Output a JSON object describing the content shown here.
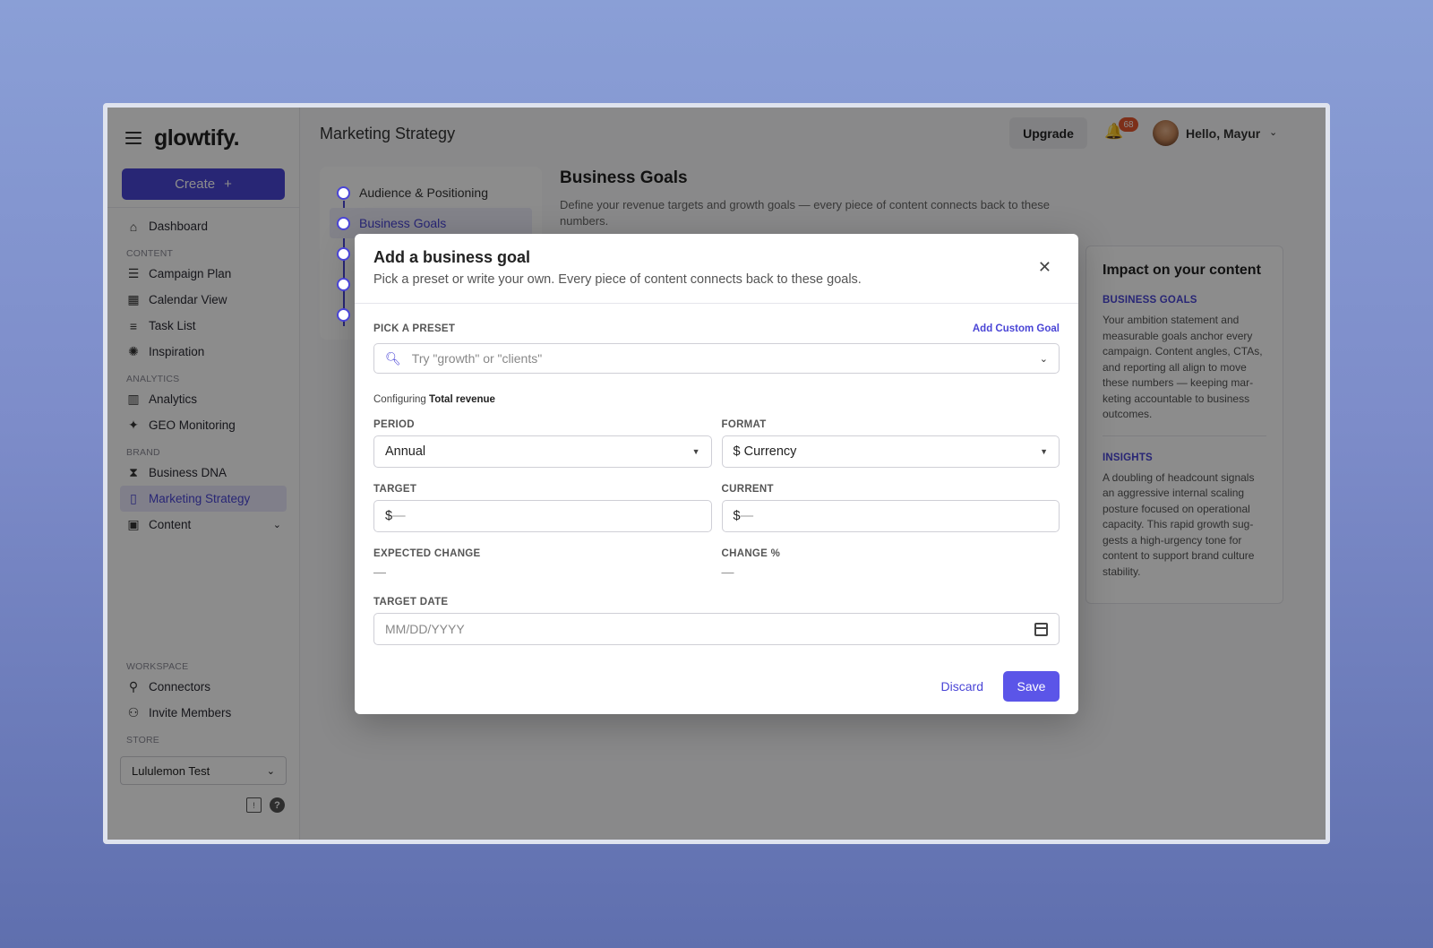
{
  "sidebar": {
    "logo": "glowtify.",
    "create_label": "Create",
    "create_plus": "+",
    "items": [
      {
        "label": "Dashboard",
        "icon": "home-icon"
      },
      {
        "label": "Campaign Plan",
        "icon": "campaign-plan-icon"
      },
      {
        "label": "Calendar View",
        "icon": "calendar-icon"
      },
      {
        "label": "Task List",
        "icon": "task-list-icon"
      },
      {
        "label": "Inspiration",
        "icon": "lightbulb-icon"
      },
      {
        "label": "Analytics",
        "icon": "bar-chart-icon"
      },
      {
        "label": "GEO Monitoring",
        "icon": "sparkle-icon"
      },
      {
        "label": "Business DNA",
        "icon": "dna-icon"
      },
      {
        "label": "Marketing Strategy",
        "icon": "book-icon"
      },
      {
        "label": "Content",
        "icon": "image-gallery-icon"
      },
      {
        "label": "Connectors",
        "icon": "connectors-icon"
      },
      {
        "label": "Invite Members",
        "icon": "invite-members-icon"
      }
    ],
    "sections": {
      "content": "CONTENT",
      "analytics": "ANALYTICS",
      "brand": "BRAND",
      "workspace": "WORKSPACE",
      "store": "STORE"
    },
    "store_value": "Lululemon Test"
  },
  "header": {
    "page_title": "Marketing Strategy",
    "upgrade_label": "Upgrade",
    "notification_count": "68",
    "greeting": "Hello, Mayur"
  },
  "steps": [
    {
      "label": "Audience & Positioning"
    },
    {
      "label": "Business Goals"
    }
  ],
  "goals": {
    "title": "Business Goals",
    "description": "Define your revenue targets and growth goals — every piece of content connects back to these numbers."
  },
  "impact": {
    "title": "Impact on your content",
    "section1_label": "BUSINESS GOALS",
    "section1_text": "Your ambition statement and measurable goals anchor every campaign. Content angles, CTAs, and reporting all align to move these numbers — keeping mar­keting accountable to business outcomes.",
    "section2_label": "INSIGHTS",
    "section2_text": "A doubling of headcount signals an aggressive internal scaling posture focused on operational capacity. This rapid growth sug­gests a high-urgency tone for content to support brand culture stability."
  },
  "modal": {
    "title": "Add a business goal",
    "subtitle": "Pick a preset or write your own. Every piece of content connects back to these goals.",
    "close_glyph": "✕",
    "pick_preset_label": "PICK A PRESET",
    "add_custom_label": "Add Custom Goal",
    "search_placeholder": "Try \"growth\" or \"clients\"",
    "configuring_prefix": "Configuring",
    "configuring_value": "Total revenue",
    "period_label": "PERIOD",
    "period_value": "Annual",
    "format_label": "FORMAT",
    "format_value": "$ Currency",
    "target_label": "TARGET",
    "target_prefix": "$",
    "target_placeholder": "—",
    "current_label": "CURRENT",
    "current_prefix": "$",
    "current_placeholder": "—",
    "expected_change_label": "EXPECTED CHANGE",
    "expected_change_value": "—",
    "change_pct_label": "CHANGE %",
    "change_pct_value": "—",
    "target_date_label": "TARGET DATE",
    "target_date_placeholder": "MM/DD/YYYY",
    "discard_label": "Discard",
    "save_label": "Save"
  }
}
